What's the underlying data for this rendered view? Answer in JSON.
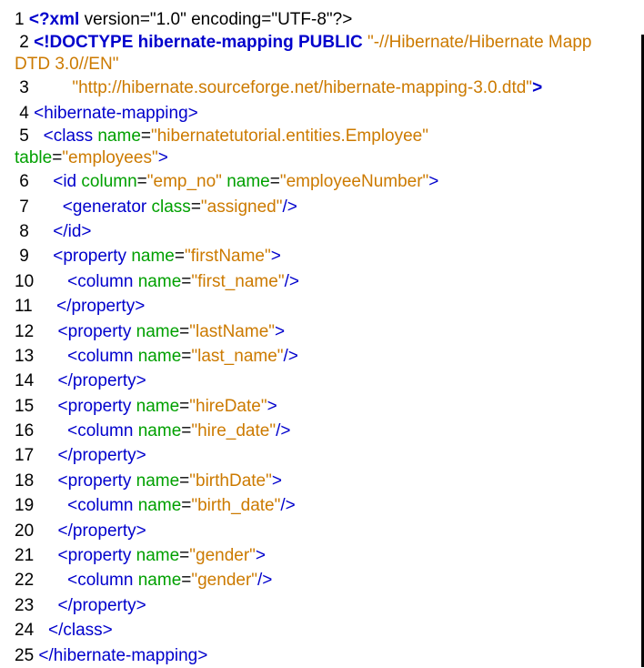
{
  "lines": [
    {
      "n": "1 ",
      "parts": [
        {
          "t": "<?xml",
          "c": "tag bold"
        },
        {
          "t": " version=\"1.0\" encoding=\"UTF-8\"?>",
          "c": "plain"
        }
      ]
    },
    {
      "n": " 2 ",
      "parts": [
        {
          "t": "<!DOCTYPE hibernate-mapping PUBLIC",
          "c": "tag bold"
        },
        {
          "t": " \"-//Hibernate/Hibernate Mapp",
          "c": "val"
        }
      ],
      "cont": [
        {
          "t": "DTD 3.0//EN\"",
          "c": "val"
        }
      ]
    },
    {
      "n": " 3 ",
      "parts": [
        {
          "t": "        \"http://hibernate.sourceforge.net/hibernate-mapping-3.0.dtd\"",
          "c": "val"
        },
        {
          "t": ">",
          "c": "tag bold"
        }
      ]
    },
    {
      "n": " 4 ",
      "parts": [
        {
          "t": "<hibernate-mapping>",
          "c": "tag"
        }
      ]
    },
    {
      "n": " 5 ",
      "parts": [
        {
          "t": "  <class",
          "c": "tag"
        },
        {
          "t": " name",
          "c": "attr"
        },
        {
          "t": "=",
          "c": "plain"
        },
        {
          "t": "\"hibernatetutorial.entities.Employee\"",
          "c": "val"
        }
      ],
      "cont": [
        {
          "t": "table",
          "c": "attr"
        },
        {
          "t": "=",
          "c": "plain"
        },
        {
          "t": "\"employees\"",
          "c": "val"
        },
        {
          "t": ">",
          "c": "tag"
        }
      ]
    },
    {
      "n": " 6 ",
      "parts": [
        {
          "t": "    <id",
          "c": "tag"
        },
        {
          "t": " column",
          "c": "attr"
        },
        {
          "t": "=",
          "c": "plain"
        },
        {
          "t": "\"emp_no\"",
          "c": "val"
        },
        {
          "t": " name",
          "c": "attr"
        },
        {
          "t": "=",
          "c": "plain"
        },
        {
          "t": "\"employeeNumber\"",
          "c": "val"
        },
        {
          "t": ">",
          "c": "tag"
        }
      ]
    },
    {
      "n": " 7 ",
      "parts": [
        {
          "t": "      <generator",
          "c": "tag"
        },
        {
          "t": " class",
          "c": "attr"
        },
        {
          "t": "=",
          "c": "plain"
        },
        {
          "t": "\"assigned\"",
          "c": "val"
        },
        {
          "t": "/>",
          "c": "tag"
        }
      ]
    },
    {
      "n": " 8 ",
      "parts": [
        {
          "t": "    </id>",
          "c": "tag"
        }
      ]
    },
    {
      "n": " 9 ",
      "parts": [
        {
          "t": "    <property",
          "c": "tag"
        },
        {
          "t": " name",
          "c": "attr"
        },
        {
          "t": "=",
          "c": "plain"
        },
        {
          "t": "\"firstName\"",
          "c": "val"
        },
        {
          "t": ">",
          "c": "tag"
        }
      ]
    },
    {
      "n": "10 ",
      "parts": [
        {
          "t": "      <column",
          "c": "tag"
        },
        {
          "t": " name",
          "c": "attr"
        },
        {
          "t": "=",
          "c": "plain"
        },
        {
          "t": "\"first_name\"",
          "c": "val"
        },
        {
          "t": "/>",
          "c": "tag"
        }
      ]
    },
    {
      "n": "11 ",
      "parts": [
        {
          "t": "    </property>",
          "c": "tag"
        }
      ]
    },
    {
      "n": "12 ",
      "parts": [
        {
          "t": "    <property",
          "c": "tag"
        },
        {
          "t": " name",
          "c": "attr"
        },
        {
          "t": "=",
          "c": "plain"
        },
        {
          "t": "\"lastName\"",
          "c": "val"
        },
        {
          "t": ">",
          "c": "tag"
        }
      ]
    },
    {
      "n": "13 ",
      "parts": [
        {
          "t": "      <column",
          "c": "tag"
        },
        {
          "t": " name",
          "c": "attr"
        },
        {
          "t": "=",
          "c": "plain"
        },
        {
          "t": "\"last_name\"",
          "c": "val"
        },
        {
          "t": "/>",
          "c": "tag"
        }
      ]
    },
    {
      "n": "14 ",
      "parts": [
        {
          "t": "    </property>",
          "c": "tag"
        }
      ]
    },
    {
      "n": "15 ",
      "parts": [
        {
          "t": "    <property",
          "c": "tag"
        },
        {
          "t": " name",
          "c": "attr"
        },
        {
          "t": "=",
          "c": "plain"
        },
        {
          "t": "\"hireDate\"",
          "c": "val"
        },
        {
          "t": ">",
          "c": "tag"
        }
      ]
    },
    {
      "n": "16 ",
      "parts": [
        {
          "t": "      <column",
          "c": "tag"
        },
        {
          "t": " name",
          "c": "attr"
        },
        {
          "t": "=",
          "c": "plain"
        },
        {
          "t": "\"hire_date\"",
          "c": "val"
        },
        {
          "t": "/>",
          "c": "tag"
        }
      ]
    },
    {
      "n": "17 ",
      "parts": [
        {
          "t": "    </property>",
          "c": "tag"
        }
      ]
    },
    {
      "n": "18 ",
      "parts": [
        {
          "t": "    <property",
          "c": "tag"
        },
        {
          "t": " name",
          "c": "attr"
        },
        {
          "t": "=",
          "c": "plain"
        },
        {
          "t": "\"birthDate\"",
          "c": "val"
        },
        {
          "t": ">",
          "c": "tag"
        }
      ]
    },
    {
      "n": "19 ",
      "parts": [
        {
          "t": "      <column",
          "c": "tag"
        },
        {
          "t": " name",
          "c": "attr"
        },
        {
          "t": "=",
          "c": "plain"
        },
        {
          "t": "\"birth_date\"",
          "c": "val"
        },
        {
          "t": "/>",
          "c": "tag"
        }
      ]
    },
    {
      "n": "20 ",
      "parts": [
        {
          "t": "    </property>",
          "c": "tag"
        }
      ]
    },
    {
      "n": "21 ",
      "parts": [
        {
          "t": "    <property",
          "c": "tag"
        },
        {
          "t": " name",
          "c": "attr"
        },
        {
          "t": "=",
          "c": "plain"
        },
        {
          "t": "\"gender\"",
          "c": "val"
        },
        {
          "t": ">",
          "c": "tag"
        }
      ]
    },
    {
      "n": "22 ",
      "parts": [
        {
          "t": "      <column",
          "c": "tag"
        },
        {
          "t": " name",
          "c": "attr"
        },
        {
          "t": "=",
          "c": "plain"
        },
        {
          "t": "\"gender\"",
          "c": "val"
        },
        {
          "t": "/>",
          "c": "tag"
        }
      ]
    },
    {
      "n": "23 ",
      "parts": [
        {
          "t": "    </property>",
          "c": "tag"
        }
      ]
    },
    {
      "n": "24 ",
      "parts": [
        {
          "t": "  </class>",
          "c": "tag"
        }
      ]
    },
    {
      "n": "25 ",
      "parts": [
        {
          "t": "</hibernate-mapping>",
          "c": "tag"
        }
      ]
    }
  ]
}
